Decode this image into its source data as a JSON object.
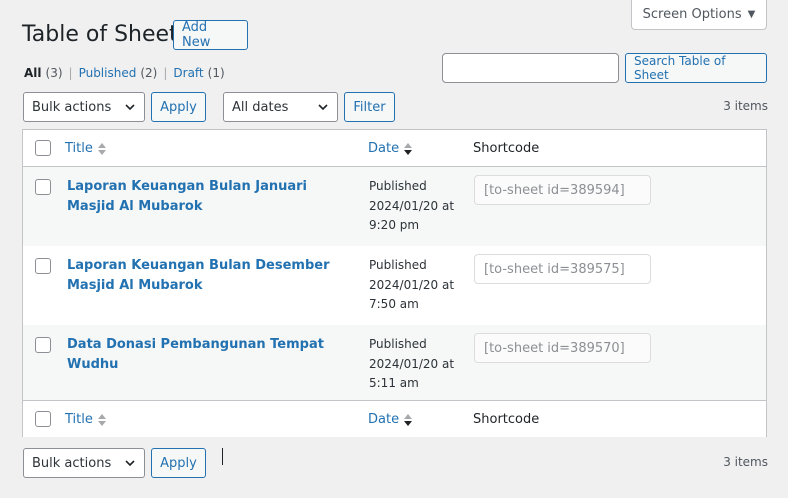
{
  "screen_options": {
    "label": "Screen Options",
    "icon": "caret-down-icon"
  },
  "header": {
    "title": "Table of Sheet",
    "add_new": "Add New"
  },
  "views": {
    "all": {
      "label": "All",
      "count": "(3)"
    },
    "published": {
      "label": "Published",
      "count": "(2)"
    },
    "draft": {
      "label": "Draft",
      "count": "(1)"
    },
    "separator": "|"
  },
  "search": {
    "placeholder": "",
    "button": "Search Table of Sheet"
  },
  "tablenav_top": {
    "bulk_actions": "Bulk actions",
    "apply": "Apply",
    "dates": "All dates",
    "filter": "Filter",
    "items": "3 items"
  },
  "columns": {
    "title": "Title",
    "date": "Date",
    "shortcode": "Shortcode"
  },
  "rows": [
    {
      "title": "Laporan Keuangan Bulan Januari Masjid Al Mubarok",
      "status": "Published",
      "date": "2024/01/20 at",
      "time": "9:20 pm",
      "shortcode": "[to-sheet id=389594]"
    },
    {
      "title": "Laporan Keuangan Bulan Desember Masjid Al Mubarok",
      "status": "Published",
      "date": "2024/01/20 at",
      "time": "7:50 am",
      "shortcode": "[to-sheet id=389575]"
    },
    {
      "title": "Data Donasi Pembangunan Tempat Wudhu",
      "status": "Published",
      "date": "2024/01/20 at",
      "time": "5:11 am",
      "shortcode": "[to-sheet id=389570]"
    }
  ],
  "tablenav_bottom": {
    "bulk_actions": "Bulk actions",
    "apply": "Apply",
    "items": "3 items"
  },
  "colors": {
    "accent": "#2271b1",
    "background": "#f0f0f1",
    "border": "#c3c4c7"
  }
}
